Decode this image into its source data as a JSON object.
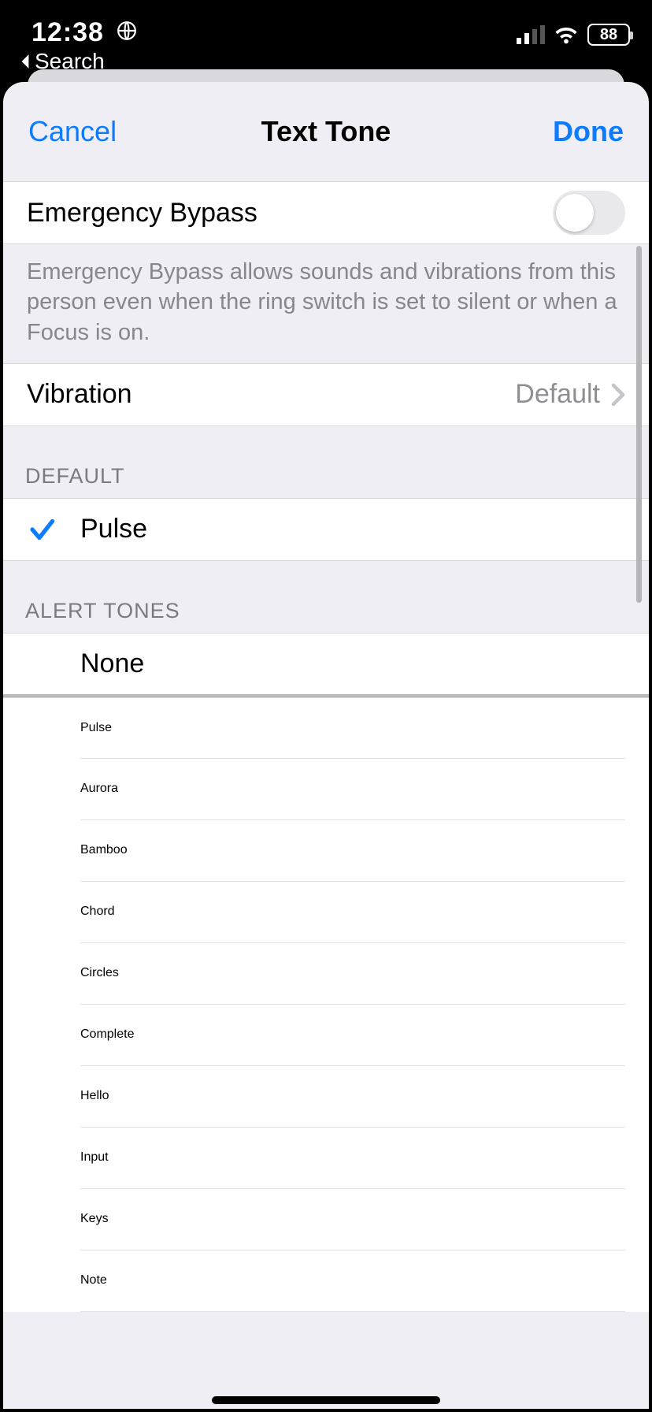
{
  "status": {
    "time": "12:38",
    "back_app": "Search",
    "battery": "88"
  },
  "header": {
    "cancel": "Cancel",
    "title": "Text Tone",
    "done": "Done"
  },
  "emergency": {
    "label": "Emergency Bypass",
    "description": "Emergency Bypass allows sounds and vibrations from this person even when the ring switch is set to silent or when a Focus is on."
  },
  "vibration": {
    "label": "Vibration",
    "value": "Default"
  },
  "sections": {
    "default_header": "DEFAULT",
    "default_tone": "Pulse",
    "alert_header": "ALERT TONES",
    "none": "None",
    "tones": [
      "Pulse",
      "Aurora",
      "Bamboo",
      "Chord",
      "Circles",
      "Complete",
      "Hello",
      "Input",
      "Keys",
      "Note"
    ]
  }
}
